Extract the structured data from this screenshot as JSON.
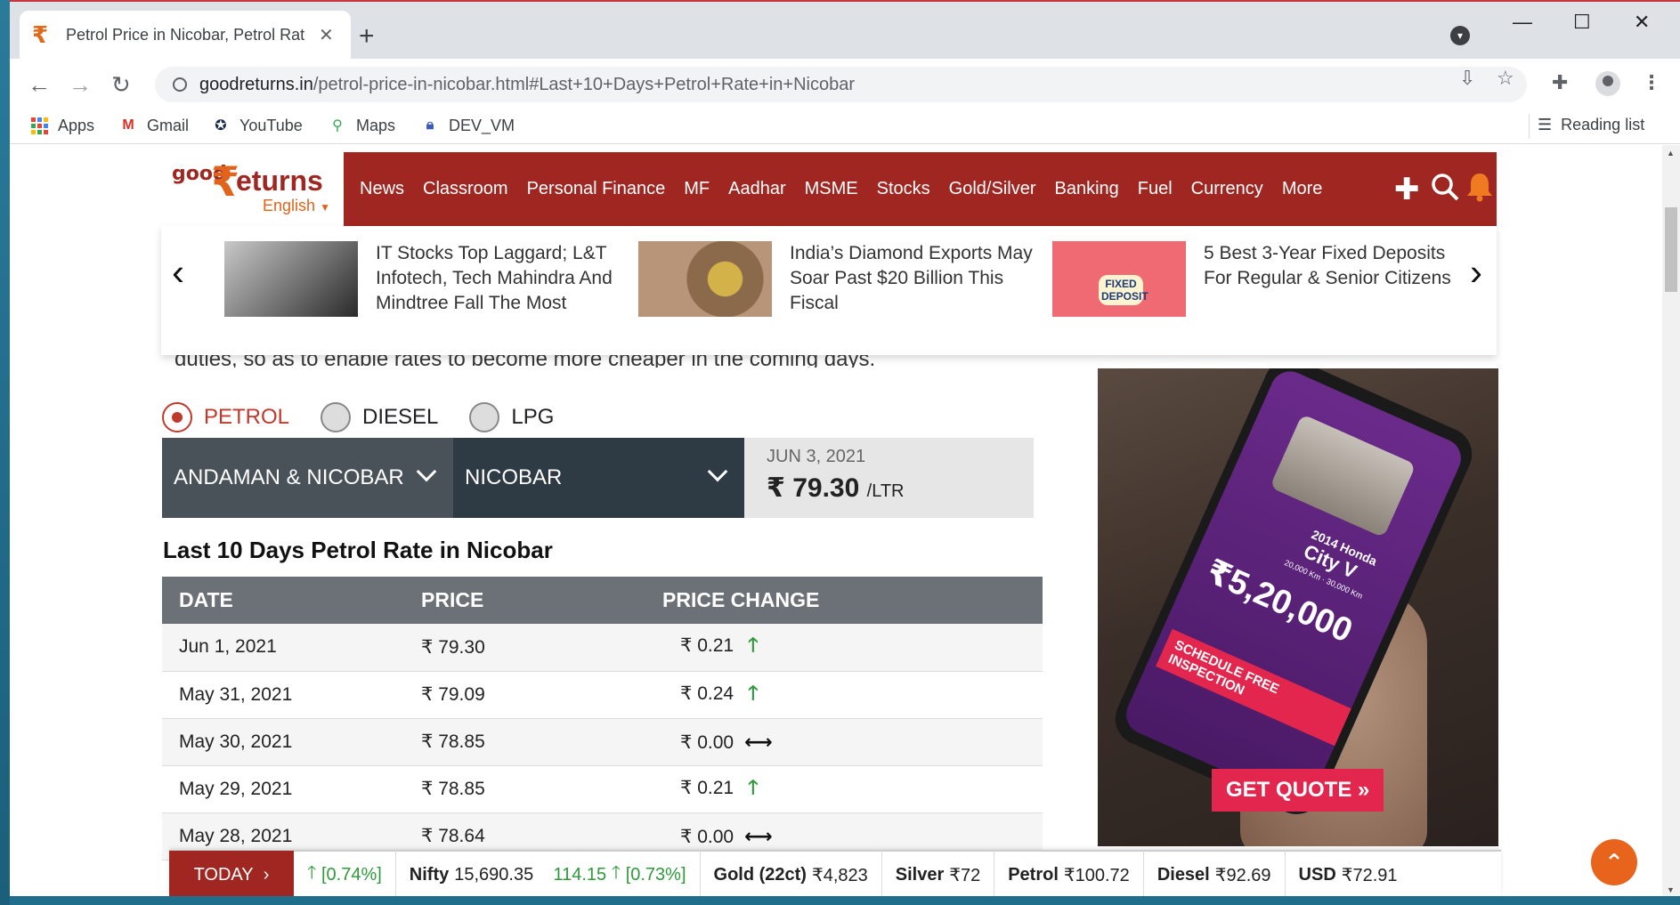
{
  "tab": {
    "title": "Petrol Price in Nicobar, Petrol Rat",
    "favicon": "₹"
  },
  "address": {
    "url_domain": "goodreturns.in",
    "url_path": "/petrol-price-in-nicobar.html#Last+10+Days+Petrol+Rate+in+Nicobar"
  },
  "bookmarks": [
    {
      "label": "Apps"
    },
    {
      "label": "Gmail"
    },
    {
      "label": "YouTube"
    },
    {
      "label": "Maps"
    },
    {
      "label": "DEV_VM"
    }
  ],
  "reading_list": "Reading list",
  "site": {
    "logo_good": "good",
    "logo_rupee": "₹",
    "logo_eturns": "eturns",
    "logo_lang": "English",
    "nav": [
      "News",
      "Classroom",
      "Personal Finance",
      "MF",
      "Aadhar",
      "MSME",
      "Stocks",
      "Gold/Silver",
      "Banking",
      "Fuel",
      "Currency",
      "More"
    ]
  },
  "carousel": [
    {
      "text": "IT Stocks Top Laggard; L&T Infotech, Tech Mahindra And Mindtree Fall The Most"
    },
    {
      "text": "India’s Diamond Exports May Soar Past $20 Billion This Fiscal"
    },
    {
      "text": "5 Best 3-Year Fixed Deposits For Regular & Senior Citizens",
      "badge": "FIXED DEPOSIT"
    }
  ],
  "cutline": "duties, so as to enable rates to become more cheaper in the coming days.",
  "fuel_options": {
    "petrol": "PETROL",
    "diesel": "DIESEL",
    "lpg": "LPG",
    "selected": "PETROL"
  },
  "state": "ANDAMAN & NICOBAR",
  "city": "NICOBAR",
  "current": {
    "date": "JUN 3, 2021",
    "price": "₹ 79.30",
    "unit": "/LTR"
  },
  "section_title": "Last 10 Days Petrol Rate in Nicobar",
  "table": {
    "headers": [
      "DATE",
      "PRICE",
      "PRICE CHANGE"
    ],
    "rows": [
      {
        "date": "Jun 1, 2021",
        "price": "₹ 79.30",
        "change": "₹ 0.21",
        "dir": "up"
      },
      {
        "date": "May 31, 2021",
        "price": "₹ 79.09",
        "change": "₹ 0.24",
        "dir": "up"
      },
      {
        "date": "May 30, 2021",
        "price": "₹ 78.85",
        "change": "₹ 0.00",
        "dir": "flat"
      },
      {
        "date": "May 29, 2021",
        "price": "₹ 78.85",
        "change": "₹ 0.21",
        "dir": "up"
      },
      {
        "date": "May 28, 2021",
        "price": "₹ 78.64",
        "change": "₹ 0.00",
        "dir": "flat"
      }
    ]
  },
  "ad": {
    "model_line1": "2014 Honda",
    "model_line2": "City V",
    "price": "₹5,20,000",
    "schedule": "SCHEDULE FREE INSPECTION",
    "cta": "GET QUOTE »",
    "odometer": "20,000 Km · 30,000 Km"
  },
  "ticker": {
    "today": "TODAY",
    "partial_change": "[0.74%]",
    "nifty_label": "Nifty",
    "nifty_value": "15,690.35",
    "nifty_change": "114.15",
    "nifty_pct": "[0.73%]",
    "gold_label": "Gold (22ct)",
    "gold_value": "₹4,823",
    "silver_label": "Silver",
    "silver_value": "₹72",
    "petrol_label": "Petrol",
    "petrol_value": "₹100.72",
    "diesel_label": "Diesel",
    "diesel_value": "₹92.69",
    "usd_label": "USD",
    "usd_value": "₹72.91"
  },
  "colors": {
    "brand": "#a02721",
    "accent": "#e0641b",
    "up": "#2e9a3a"
  },
  "icons": [
    "back-icon",
    "forward-icon",
    "reload-icon",
    "lock-icon",
    "install-icon",
    "star-icon",
    "extensions-icon",
    "profile-icon",
    "menu-icon",
    "puzzle-icon",
    "search-icon",
    "bell-icon",
    "arrow-up-icon",
    "arrow-both-icon",
    "back-to-top-icon"
  ]
}
